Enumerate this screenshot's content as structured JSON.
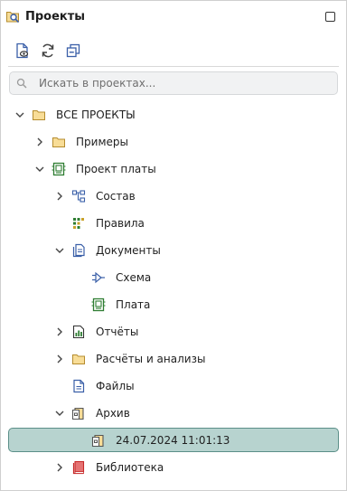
{
  "panel": {
    "title": "Проекты",
    "title_icon": "project-search-icon",
    "maximize_icon": "maximize-icon"
  },
  "toolbar": {
    "buttons": [
      {
        "icon": "file-view-icon"
      },
      {
        "icon": "refresh-icon"
      },
      {
        "icon": "collapse-all-icon"
      }
    ]
  },
  "search": {
    "placeholder": "Искать в проектах...",
    "value": "",
    "icon": "search-icon"
  },
  "colors": {
    "selection": "#b7d3cf",
    "selection_border": "#5b8f88",
    "folder": "#f2d48a",
    "folder_stroke": "#b58c2e",
    "board": "#2e7d32",
    "doc_blue": "#3a5fa8",
    "book_red": "#c62828"
  },
  "tree": {
    "root": {
      "label": "ВСЕ ПРОЕКТЫ",
      "icon": "folder-icon",
      "expanded": true
    },
    "items": [
      {
        "label": "Примеры",
        "icon": "folder-icon",
        "expanded": false
      },
      {
        "label": "Проект платы",
        "icon": "board-icon",
        "expanded": true
      },
      {
        "label": "Состав",
        "icon": "hierarchy-icon",
        "expanded": false
      },
      {
        "label": "Правила",
        "icon": "rules-icon"
      },
      {
        "label": "Документы",
        "icon": "documents-icon",
        "expanded": true
      },
      {
        "label": "Схема",
        "icon": "schematic-icon"
      },
      {
        "label": "Плата",
        "icon": "board-icon"
      },
      {
        "label": "Отчёты",
        "icon": "report-icon",
        "expanded": false
      },
      {
        "label": "Расчёты и анализы",
        "icon": "folder-icon",
        "expanded": false
      },
      {
        "label": "Файлы",
        "icon": "file-icon"
      },
      {
        "label": "Архив",
        "icon": "archive-icon",
        "expanded": true
      },
      {
        "label": "24.07.2024 11:01:13",
        "icon": "archive-entry-icon",
        "selected": true
      },
      {
        "label": "Библиотека",
        "icon": "library-icon",
        "expanded": false
      }
    ]
  }
}
